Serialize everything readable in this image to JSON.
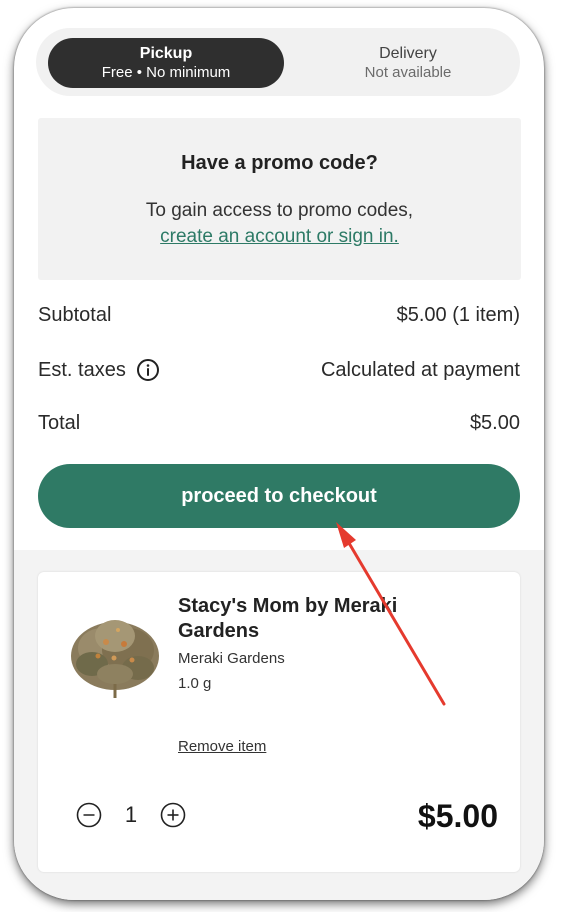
{
  "fulfillment": {
    "pickup": {
      "title": "Pickup",
      "subtitle": "Free • No minimum",
      "selected": true
    },
    "delivery": {
      "title": "Delivery",
      "subtitle": "Not available",
      "selected": false
    }
  },
  "promo": {
    "title": "Have a promo code?",
    "text": "To gain access to promo codes,",
    "link": "create an account or sign in."
  },
  "summary": {
    "subtotal_label": "Subtotal",
    "subtotal_value": "$5.00 (1 item)",
    "taxes_label": "Est. taxes",
    "taxes_value": "Calculated at payment",
    "total_label": "Total",
    "total_value": "$5.00"
  },
  "checkout_label": "proceed to checkout",
  "cart": {
    "item": {
      "name": "Stacy's Mom by Meraki Gardens",
      "brand": "Meraki Gardens",
      "weight": "1.0 g",
      "remove_label": "Remove item",
      "quantity": "1",
      "price": "$5.00",
      "image_icon": "cannabis-bud-image"
    }
  },
  "colors": {
    "accent": "#2f7a65",
    "toggle_selected": "#2f2f2f",
    "annotation_arrow": "#e53a2e"
  },
  "icons": {
    "info": "info-icon",
    "decrement": "minus-circle-icon",
    "increment": "plus-circle-icon"
  }
}
